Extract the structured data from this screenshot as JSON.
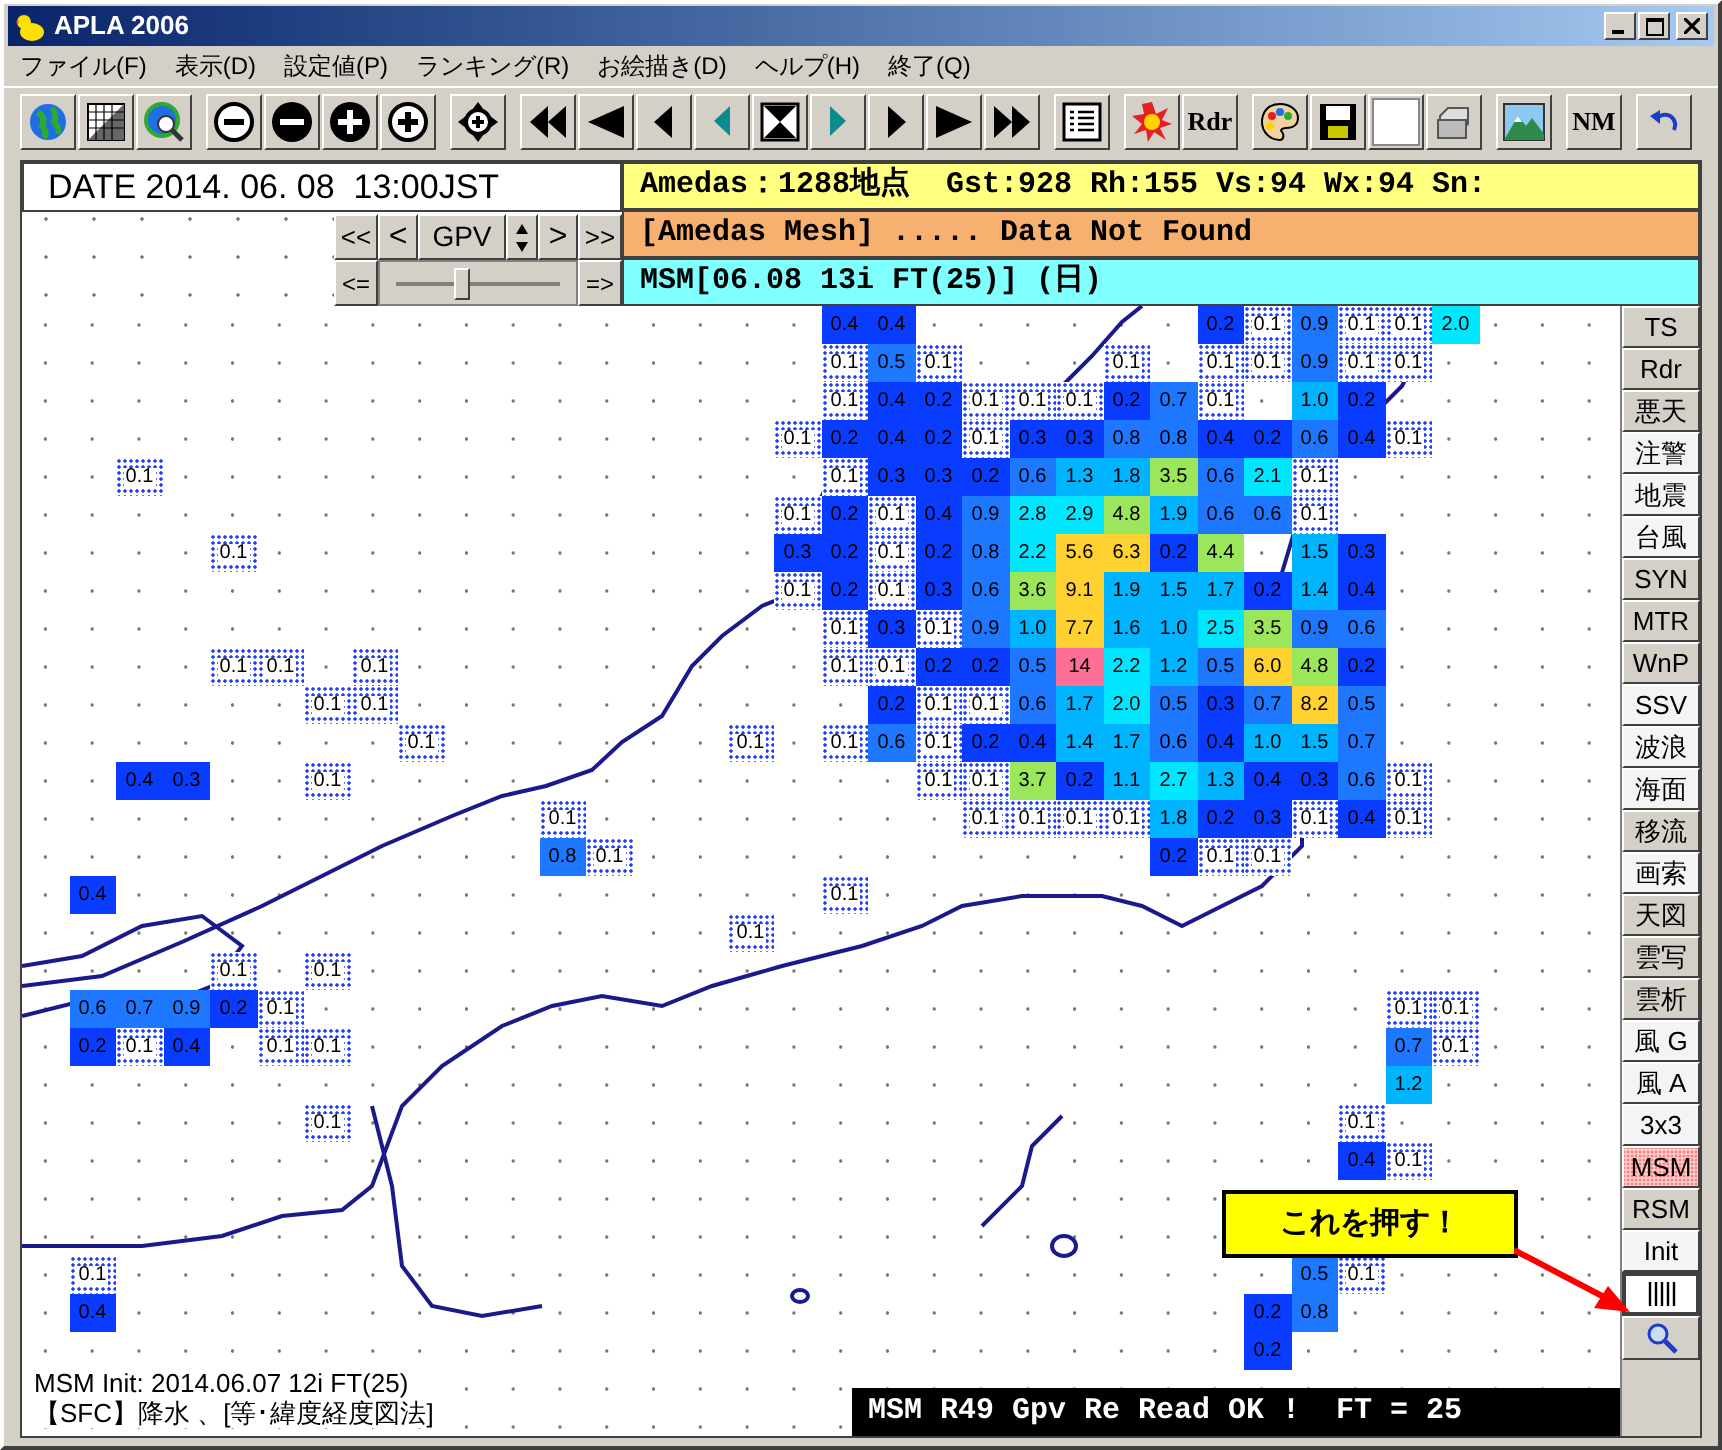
{
  "window": {
    "title": "APLA 2006"
  },
  "menu": [
    "ファイル(F)",
    "表示(D)",
    "設定値(P)",
    "ランキング(R)",
    "お絵描き(D)",
    "ヘルプ(H)",
    "終了(Q)"
  ],
  "toolbar": [
    {
      "kind": "globe"
    },
    {
      "kind": "grid"
    },
    {
      "kind": "globe-search"
    },
    {
      "kind": "minus-outline"
    },
    {
      "kind": "minus-solid"
    },
    {
      "kind": "plus-solid"
    },
    {
      "kind": "plus-outline"
    },
    {
      "kind": "move"
    },
    {
      "kind": "first"
    },
    {
      "kind": "back-big"
    },
    {
      "kind": "back"
    },
    {
      "kind": "back-teal"
    },
    {
      "kind": "hourglass"
    },
    {
      "kind": "next-teal"
    },
    {
      "kind": "next"
    },
    {
      "kind": "next-big"
    },
    {
      "kind": "last"
    },
    {
      "kind": "list"
    },
    {
      "kind": "burst"
    },
    {
      "kind": "text",
      "label": "Rdr"
    },
    {
      "kind": "palette"
    },
    {
      "kind": "save"
    },
    {
      "kind": "blank"
    },
    {
      "kind": "printer"
    },
    {
      "kind": "mountain"
    },
    {
      "kind": "text",
      "label": "NM"
    },
    {
      "kind": "undo"
    }
  ],
  "date": "DATE 2014. 06. 08  13:00JST",
  "controls": {
    "first": "<<",
    "prev": "<",
    "model": "GPV",
    "next": ">",
    "last": ">>",
    "step_back": "<=",
    "step_forward": "=>",
    "level": 0.42
  },
  "bars": [
    {
      "kind": "yellow",
      "text": "Amedas：1288地点  Gst:928 Rh:155 Vs:94 Wx:94 Sn:"
    },
    {
      "kind": "orange",
      "text": "[Amedas Mesh] ..... Data Not Found"
    },
    {
      "kind": "cyan",
      "text": "MSM[06.08 13i FT(25)] (日)"
    }
  ],
  "side_buttons": [
    {
      "label": "TS",
      "shaded": true,
      "selected": false
    },
    {
      "label": "Rdr",
      "shaded": true,
      "selected": false
    },
    {
      "label": "悪天",
      "shaded": true,
      "selected": false
    },
    {
      "label": "注警",
      "shaded": false,
      "selected": false
    },
    {
      "label": "地震",
      "shaded": false,
      "selected": false
    },
    {
      "label": "台風",
      "shaded": false,
      "selected": false
    },
    {
      "label": "SYN",
      "shaded": true,
      "selected": false
    },
    {
      "label": "MTR",
      "shaded": true,
      "selected": false
    },
    {
      "label": "WnP",
      "shaded": true,
      "selected": false
    },
    {
      "label": "SSV",
      "shaded": false,
      "selected": false
    },
    {
      "label": "波浪",
      "shaded": false,
      "selected": false
    },
    {
      "label": "海面",
      "shaded": false,
      "selected": false
    },
    {
      "label": "移流",
      "shaded": true,
      "selected": false
    },
    {
      "label": "画索",
      "shaded": false,
      "selected": false
    },
    {
      "label": "天図",
      "shaded": true,
      "selected": false
    },
    {
      "label": "雲写",
      "shaded": true,
      "selected": false
    },
    {
      "label": "雲析",
      "shaded": true,
      "selected": false
    },
    {
      "label": "風 G",
      "shaded": false,
      "selected": false
    },
    {
      "label": "風 A",
      "shaded": false,
      "selected": false
    },
    {
      "label": "3x3",
      "shaded": false,
      "selected": false
    },
    {
      "label": "MSM",
      "shaded": false,
      "selected": true
    },
    {
      "label": "RSM",
      "shaded": true,
      "selected": false
    },
    {
      "label": "Init",
      "shaded": false,
      "selected": false
    }
  ],
  "map": {
    "rows": [
      [
        null,
        null,
        null,
        null,
        null,
        null,
        null,
        null,
        null,
        null,
        null,
        null,
        null,
        null,
        null,
        null,
        null,
        "0.4",
        "0.4",
        null,
        null,
        null,
        null,
        null,
        null,
        "0.2",
        "0.1",
        "0.9",
        "0.1",
        "0.1",
        "2.0"
      ],
      [
        null,
        null,
        null,
        null,
        null,
        null,
        null,
        null,
        null,
        null,
        null,
        null,
        null,
        null,
        null,
        null,
        null,
        "0.1",
        "0.5",
        "0.1",
        null,
        null,
        null,
        "0.1",
        null,
        "0.1",
        "0.1",
        "0.9",
        "0.1",
        "0.1"
      ],
      [
        null,
        null,
        null,
        null,
        null,
        null,
        null,
        null,
        null,
        null,
        null,
        null,
        null,
        null,
        null,
        null,
        null,
        "0.1",
        "0.4",
        "0.2",
        "0.1",
        "0.1",
        "0.1",
        "0.2",
        "0.7",
        "0.1",
        null,
        "1.0",
        "0.2"
      ],
      [
        null,
        null,
        null,
        null,
        null,
        null,
        null,
        null,
        null,
        null,
        null,
        null,
        null,
        null,
        null,
        null,
        "0.1",
        "0.2",
        "0.4",
        "0.2",
        "0.1",
        "0.3",
        "0.3",
        "0.8",
        "0.8",
        "0.4",
        "0.2",
        "0.6",
        "0.4",
        "0.1"
      ],
      [
        null,
        null,
        "0.1",
        null,
        null,
        null,
        null,
        null,
        null,
        null,
        null,
        null,
        null,
        null,
        null,
        null,
        null,
        "0.1",
        "0.3",
        "0.3",
        "0.2",
        "0.6",
        "1.3",
        "1.8",
        "3.5",
        "0.6",
        "2.1",
        "0.1"
      ],
      [
        null,
        null,
        null,
        null,
        null,
        null,
        null,
        null,
        null,
        null,
        null,
        null,
        null,
        null,
        null,
        null,
        "0.1",
        "0.2",
        "0.1",
        "0.4",
        "0.9",
        "2.8",
        "2.9",
        "4.8",
        "1.9",
        "0.6",
        "0.6",
        "0.1"
      ],
      [
        null,
        null,
        null,
        null,
        "0.1",
        null,
        null,
        null,
        null,
        null,
        null,
        null,
        null,
        null,
        null,
        null,
        "0.3",
        "0.2",
        "0.1",
        "0.2",
        "0.8",
        "2.2",
        "5.6",
        "6.3",
        "0.2",
        "4.4",
        null,
        "1.5",
        "0.3"
      ],
      [
        null,
        null,
        null,
        null,
        null,
        null,
        null,
        null,
        null,
        null,
        null,
        null,
        null,
        null,
        null,
        null,
        "0.1",
        "0.2",
        "0.1",
        "0.3",
        "0.6",
        "3.6",
        "9.1",
        "1.9",
        "1.5",
        "1.7",
        "0.2",
        "1.4",
        "0.4"
      ],
      [
        null,
        null,
        null,
        null,
        null,
        null,
        null,
        null,
        null,
        null,
        null,
        null,
        null,
        null,
        null,
        null,
        null,
        "0.1",
        "0.3",
        "0.1",
        "0.9",
        "1.0",
        "7.7",
        "1.6",
        "1.0",
        "2.5",
        "3.5",
        "0.9",
        "0.6"
      ],
      [
        null,
        null,
        null,
        null,
        "0.1",
        "0.1",
        null,
        "0.1",
        null,
        null,
        null,
        null,
        null,
        null,
        null,
        null,
        null,
        "0.1",
        "0.1",
        "0.2",
        "0.2",
        "0.5",
        "14",
        "2.2",
        "1.2",
        "0.5",
        "6.0",
        "4.8",
        "0.2"
      ],
      [
        null,
        null,
        null,
        null,
        null,
        null,
        "0.1",
        "0.1",
        null,
        null,
        null,
        null,
        null,
        null,
        null,
        null,
        null,
        null,
        "0.2",
        "0.1",
        "0.1",
        "0.6",
        "1.7",
        "2.0",
        "0.5",
        "0.3",
        "0.7",
        "8.2",
        "0.5"
      ],
      [
        null,
        null,
        null,
        null,
        null,
        null,
        null,
        null,
        "0.1",
        null,
        null,
        null,
        null,
        null,
        null,
        "0.1",
        null,
        "0.1",
        "0.6",
        "0.1",
        "0.2",
        "0.4",
        "1.4",
        "1.7",
        "0.6",
        "0.4",
        "1.0",
        "1.5",
        "0.7"
      ],
      [
        null,
        null,
        "0.4",
        "0.3",
        null,
        null,
        "0.1",
        null,
        null,
        null,
        null,
        null,
        null,
        null,
        null,
        null,
        null,
        null,
        null,
        "0.1",
        "0.1",
        "3.7",
        "0.2",
        "1.1",
        "2.7",
        "1.3",
        "0.4",
        "0.3",
        "0.6",
        "0.1"
      ],
      [
        null,
        null,
        null,
        null,
        null,
        null,
        null,
        null,
        null,
        null,
        null,
        "0.1",
        null,
        null,
        null,
        null,
        null,
        null,
        null,
        null,
        "0.1",
        "0.1",
        "0.1",
        "0.1",
        "1.8",
        "0.2",
        "0.3",
        "0.1",
        "0.4",
        "0.1"
      ],
      [
        null,
        null,
        null,
        null,
        null,
        null,
        null,
        null,
        null,
        null,
        null,
        "0.8",
        "0.1",
        null,
        null,
        null,
        null,
        null,
        null,
        null,
        null,
        null,
        null,
        null,
        "0.2",
        "0.1",
        "0.1"
      ],
      [
        null,
        "0.4",
        null,
        null,
        null,
        null,
        null,
        null,
        null,
        null,
        null,
        null,
        null,
        null,
        null,
        null,
        null,
        "0.1"
      ],
      [
        null,
        null,
        null,
        null,
        null,
        null,
        null,
        null,
        null,
        null,
        null,
        null,
        null,
        null,
        null,
        "0.1"
      ],
      [
        null,
        null,
        null,
        null,
        "0.1",
        null,
        "0.1"
      ],
      [
        null,
        "0.6",
        "0.7",
        "0.9",
        "0.2",
        "0.1",
        null,
        null,
        null,
        null,
        null,
        null,
        null,
        null,
        null,
        null,
        null,
        null,
        null,
        null,
        null,
        null,
        null,
        null,
        null,
        null,
        null,
        null,
        null,
        "0.1",
        "0.1"
      ],
      [
        null,
        "0.2",
        "0.1",
        "0.4",
        null,
        "0.1",
        "0.1",
        null,
        null,
        null,
        null,
        null,
        null,
        null,
        null,
        null,
        null,
        null,
        null,
        null,
        null,
        null,
        null,
        null,
        null,
        null,
        null,
        null,
        null,
        "0.7",
        "0.1"
      ],
      [
        null,
        null,
        null,
        null,
        null,
        null,
        null,
        null,
        null,
        null,
        null,
        null,
        null,
        null,
        null,
        null,
        null,
        null,
        null,
        null,
        null,
        null,
        null,
        null,
        null,
        null,
        null,
        null,
        null,
        "1.2"
      ],
      [
        null,
        null,
        null,
        null,
        null,
        null,
        "0.1",
        null,
        null,
        null,
        null,
        null,
        null,
        null,
        null,
        null,
        null,
        null,
        null,
        null,
        null,
        null,
        null,
        null,
        null,
        null,
        null,
        null,
        "0.1"
      ],
      [
        null,
        null,
        null,
        null,
        null,
        null,
        null,
        null,
        null,
        null,
        null,
        null,
        null,
        null,
        null,
        null,
        null,
        null,
        null,
        null,
        null,
        null,
        null,
        null,
        null,
        null,
        null,
        null,
        "0.4",
        "0.1"
      ],
      [
        null
      ],
      [
        null
      ],
      [
        null,
        "0.1",
        null,
        null,
        null,
        null,
        null,
        null,
        null,
        null,
        null,
        null,
        null,
        null,
        null,
        null,
        null,
        null,
        null,
        null,
        null,
        null,
        null,
        null,
        null,
        null,
        null,
        "0.5",
        "0.1"
      ],
      [
        null,
        "0.4",
        null,
        null,
        null,
        null,
        null,
        null,
        null,
        null,
        null,
        null,
        null,
        null,
        null,
        null,
        null,
        null,
        null,
        null,
        null,
        null,
        null,
        null,
        null,
        null,
        "0.2",
        "0.8"
      ],
      [
        null,
        null,
        null,
        null,
        null,
        null,
        null,
        null,
        null,
        null,
        null,
        null,
        null,
        null,
        null,
        null,
        null,
        null,
        null,
        null,
        null,
        null,
        null,
        null,
        null,
        null,
        "0.2"
      ]
    ],
    "init": "MSM Init: 2014.06.07 12i FT(25)",
    "projection": "【SFC】降水 、[等･緯度経度図法]",
    "callout": "これを押す！"
  },
  "status": "MSM R49 Gpv Re Read OK !  FT = 25"
}
